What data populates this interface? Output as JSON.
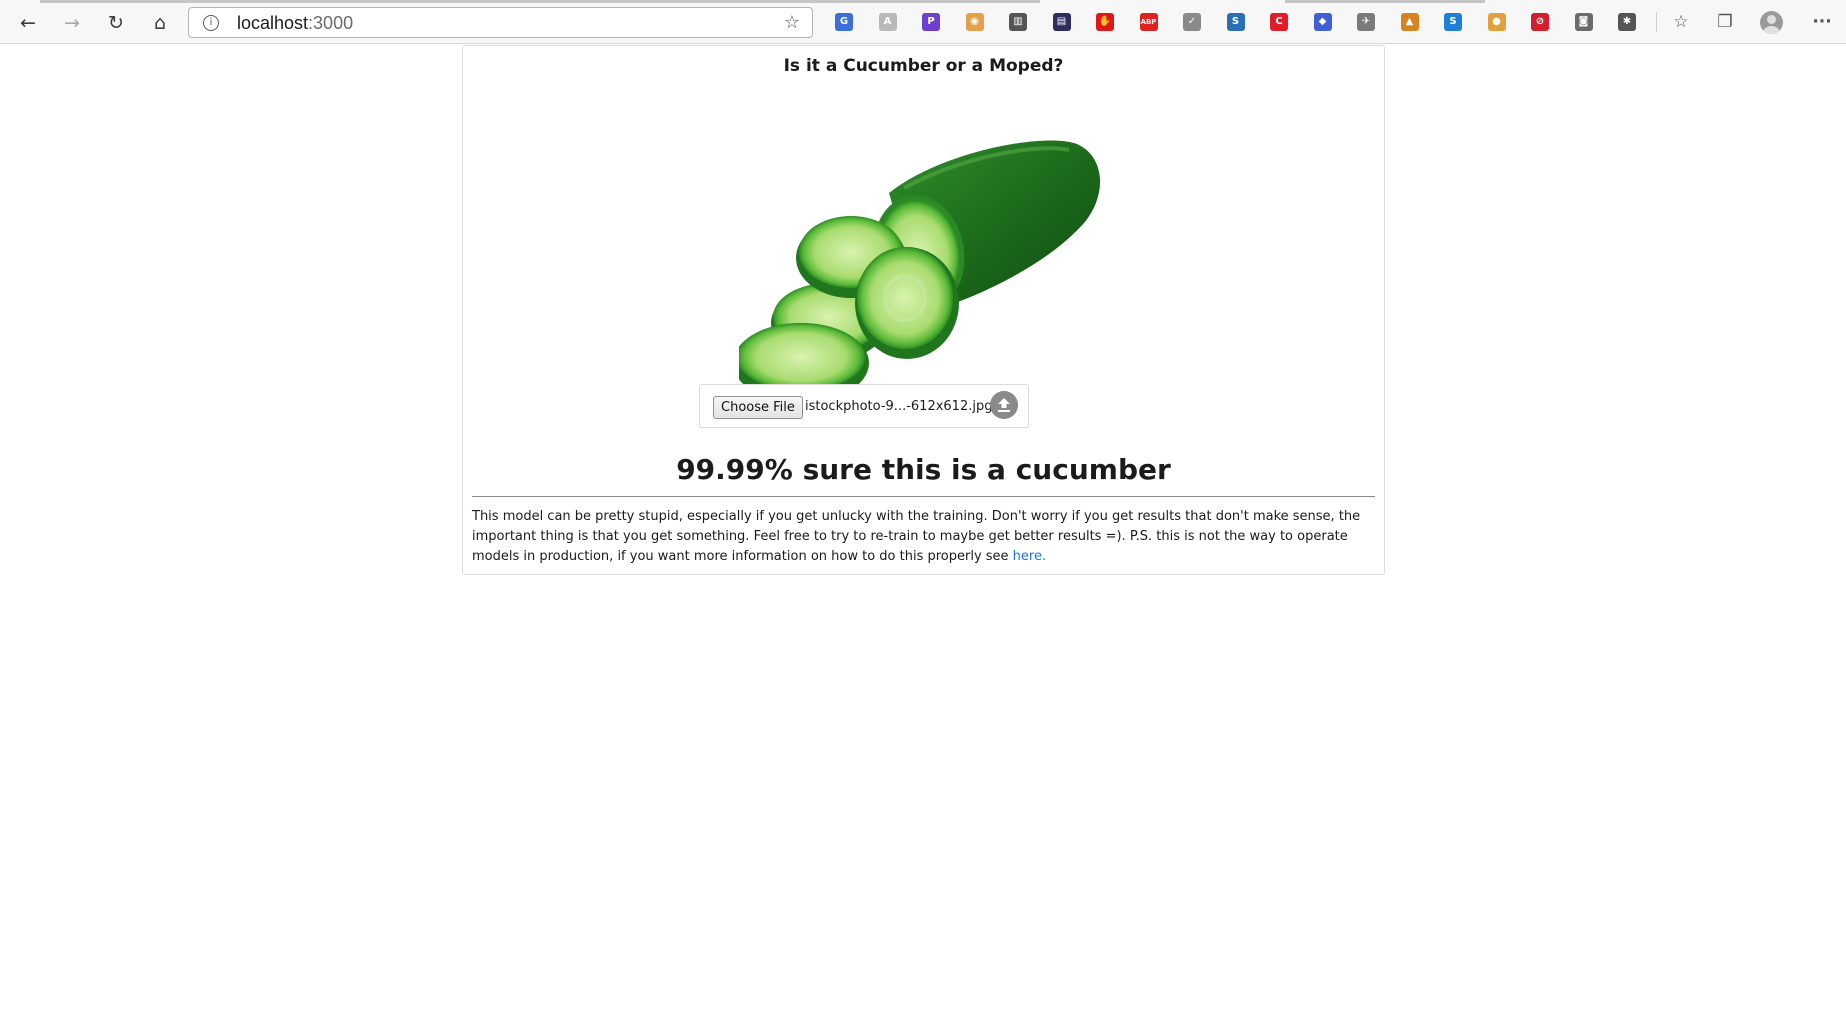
{
  "browser": {
    "url_host": "localhost",
    "url_port": ":3000",
    "nav_icons": {
      "back": "back-arrow-icon",
      "forward": "forward-arrow-icon",
      "reload": "reload-icon",
      "home": "home-icon",
      "info": "site-info-icon",
      "favorite": "add-favorite-icon"
    },
    "extensions": [
      {
        "name": "translate-extension-icon",
        "color": "#3b6ed8",
        "glyph": "G"
      },
      {
        "name": "text-extension-icon",
        "color": "#b9b9b9",
        "glyph": "A"
      },
      {
        "name": "p2-extension-icon",
        "color": "#6d3fd1",
        "glyph": "P"
      },
      {
        "name": "colorful-extension-icon",
        "color": "#e3a14a",
        "glyph": "◉"
      },
      {
        "name": "archive-extension-icon",
        "color": "#555555",
        "glyph": "▥"
      },
      {
        "name": "film-extension-icon",
        "color": "#2e2e5e",
        "glyph": "▤"
      },
      {
        "name": "red-hand-extension-icon",
        "color": "#e01717",
        "glyph": "✋"
      },
      {
        "name": "adblock-extension-icon",
        "color": "#e02121",
        "glyph": "ABP"
      },
      {
        "name": "check-extension-icon",
        "color": "#8a8a8a",
        "glyph": "✓"
      },
      {
        "name": "screenshot-extension-icon",
        "color": "#2b6fb6",
        "glyph": "S"
      },
      {
        "name": "red-c-extension-icon",
        "color": "#e21d2b",
        "glyph": "C"
      },
      {
        "name": "graduation-extension-icon",
        "color": "#3f5fd6",
        "glyph": "◆"
      },
      {
        "name": "satellite-extension-icon",
        "color": "#7a7a7a",
        "glyph": "✈"
      },
      {
        "name": "orange-extension-icon",
        "color": "#d9821f",
        "glyph": "▲"
      },
      {
        "name": "blue-s-extension-icon",
        "color": "#1f7fd6",
        "glyph": "S"
      },
      {
        "name": "cookie-extension-icon",
        "color": "#e2a23b",
        "glyph": "●"
      },
      {
        "name": "no-extension-icon",
        "color": "#d31f2d",
        "glyph": "⊘"
      },
      {
        "name": "camera-extension-icon",
        "color": "#6b6b6b",
        "glyph": "◙"
      },
      {
        "name": "extensions-puzzle-icon",
        "color": "#555555",
        "glyph": "✱"
      }
    ],
    "right_icons": {
      "favorites": "favorites-icon",
      "collections": "collections-icon",
      "profile": "profile-avatar-icon",
      "menu": "more-menu-icon"
    },
    "menu_glyph": "···"
  },
  "page": {
    "title": "Is it a Cucumber or a Moped?",
    "preview_image": "cucumber-image",
    "upload": {
      "choose_label": "Choose File",
      "file_name": "istockphoto-9...-612x612.jpg",
      "upload_icon": "upload-icon"
    },
    "result": "99.99% sure this is a cucumber",
    "note_text": "This model can be pretty stupid, especially if you get unlucky with the training. Don't worry if you get results that don't make sense, the important thing is that you get something. Feel free to try to re-train to maybe get better results =). P.S. this is not the way to operate models in production, if you want more information on how to do this properly see ",
    "note_link": "here."
  }
}
